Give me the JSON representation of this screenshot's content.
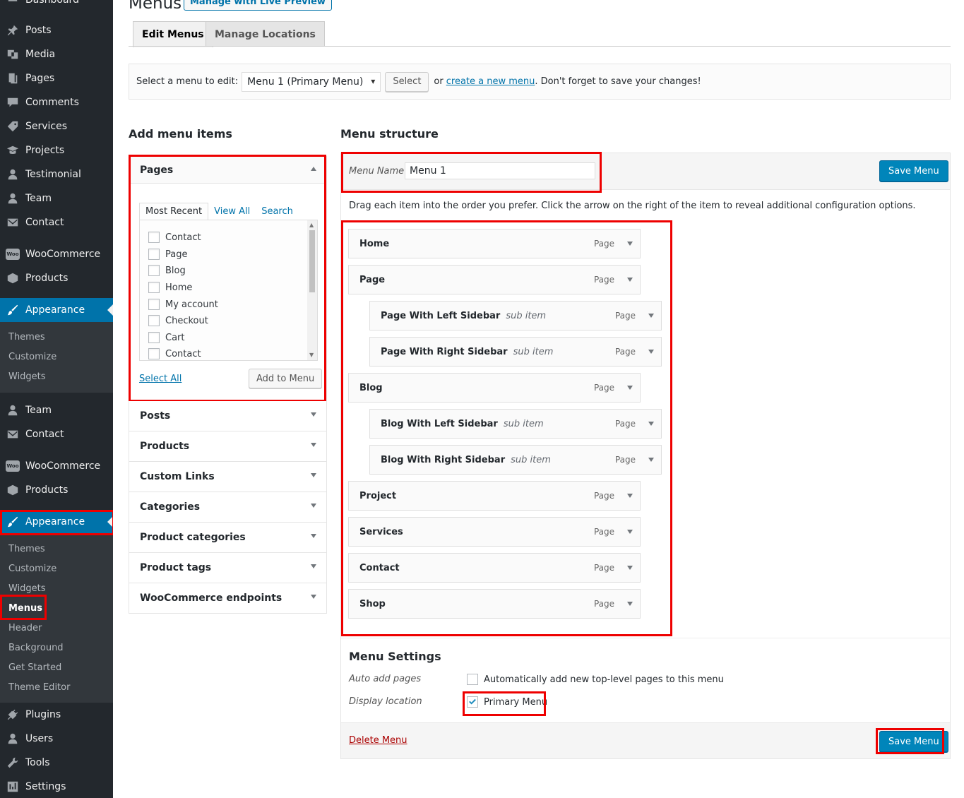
{
  "sidebar": {
    "top_cut_label": "Dashboard",
    "items": [
      {
        "label": "Posts",
        "icon": "pin-icon"
      },
      {
        "label": "Media",
        "icon": "media-icon"
      },
      {
        "label": "Pages",
        "icon": "pages-icon"
      },
      {
        "label": "Comments",
        "icon": "comments-icon"
      },
      {
        "label": "Services",
        "icon": "tag-icon"
      },
      {
        "label": "Projects",
        "icon": "graduation-icon"
      },
      {
        "label": "Testimonial",
        "icon": "user-icon"
      },
      {
        "label": "Team",
        "icon": "user-icon"
      },
      {
        "label": "Contact",
        "icon": "mail-icon"
      },
      {
        "label": "WooCommerce",
        "icon": "woo-icon"
      },
      {
        "label": "Products",
        "icon": "box-icon"
      },
      {
        "label": "Appearance",
        "icon": "brush-icon"
      },
      {
        "label": "Team",
        "icon": "user-icon"
      },
      {
        "label": "Contact",
        "icon": "mail-icon"
      },
      {
        "label": "WooCommerce",
        "icon": "woo-icon"
      },
      {
        "label": "Products",
        "icon": "box-icon"
      },
      {
        "label": "Appearance",
        "icon": "brush-icon"
      },
      {
        "label": "Plugins",
        "icon": "plugin-icon"
      },
      {
        "label": "Users",
        "icon": "user-icon"
      },
      {
        "label": "Tools",
        "icon": "wrench-icon"
      },
      {
        "label": "Settings",
        "icon": "settings-icon"
      }
    ],
    "woo_badge": "Woo",
    "submenu1": [
      "Themes",
      "Customize",
      "Widgets"
    ],
    "submenu2": [
      "Themes",
      "Customize",
      "Widgets",
      "Menus",
      "Header",
      "Background",
      "Get Started",
      "Theme Editor"
    ]
  },
  "header": {
    "title": "Menus",
    "live_preview": "Manage with Live Preview"
  },
  "tabs": [
    "Edit Menus",
    "Manage Locations"
  ],
  "manage": {
    "prefix": "Select a menu to edit:",
    "selected": "Menu 1 (Primary Menu)",
    "select_btn": "Select",
    "or": "or",
    "create_link": "create a new menu",
    "suffix": ". Don't forget to save your changes!"
  },
  "add_items": {
    "title": "Add menu items",
    "pages": {
      "title": "Pages",
      "tabs": [
        "Most Recent",
        "View All",
        "Search"
      ],
      "list": [
        "Contact",
        "Page",
        "Blog",
        "Home",
        "My account",
        "Checkout",
        "Cart",
        "Contact"
      ],
      "select_all": "Select All",
      "add_btn": "Add to Menu"
    },
    "sections": [
      "Posts",
      "Products",
      "Custom Links",
      "Categories",
      "Product categories",
      "Product tags",
      "WooCommerce endpoints"
    ]
  },
  "structure": {
    "title": "Menu structure",
    "name_label": "Menu Name",
    "name_value": "Menu 1",
    "save_btn": "Save Menu",
    "instructions": "Drag each item into the order you prefer. Click the arrow on the right of the item to reveal additional configuration options.",
    "items": [
      {
        "title": "Home",
        "type": "Page",
        "sub": ""
      },
      {
        "title": "Page",
        "type": "Page",
        "sub": ""
      },
      {
        "title": "Page With Left Sidebar",
        "type": "Page",
        "sub": "sub item"
      },
      {
        "title": "Page With Right Sidebar",
        "type": "Page",
        "sub": "sub item"
      },
      {
        "title": "Blog",
        "type": "Page",
        "sub": ""
      },
      {
        "title": "Blog With Left Sidebar",
        "type": "Page",
        "sub": "sub item"
      },
      {
        "title": "Blog With Right Sidebar",
        "type": "Page",
        "sub": "sub item"
      },
      {
        "title": "Project",
        "type": "Page",
        "sub": ""
      },
      {
        "title": "Services",
        "type": "Page",
        "sub": ""
      },
      {
        "title": "Contact",
        "type": "Page",
        "sub": ""
      },
      {
        "title": "Shop",
        "type": "Page",
        "sub": ""
      }
    ],
    "settings": {
      "title": "Menu Settings",
      "auto_label": "Auto add pages",
      "auto_text": "Automatically add new top-level pages to this menu",
      "location_label": "Display location",
      "location_text": "Primary Menu"
    },
    "delete_link": "Delete Menu",
    "save_btn_bottom": "Save Menu"
  },
  "colors": {
    "accent": "#0073aa",
    "highlight_box": "#e00000",
    "button": "#0085ba"
  }
}
